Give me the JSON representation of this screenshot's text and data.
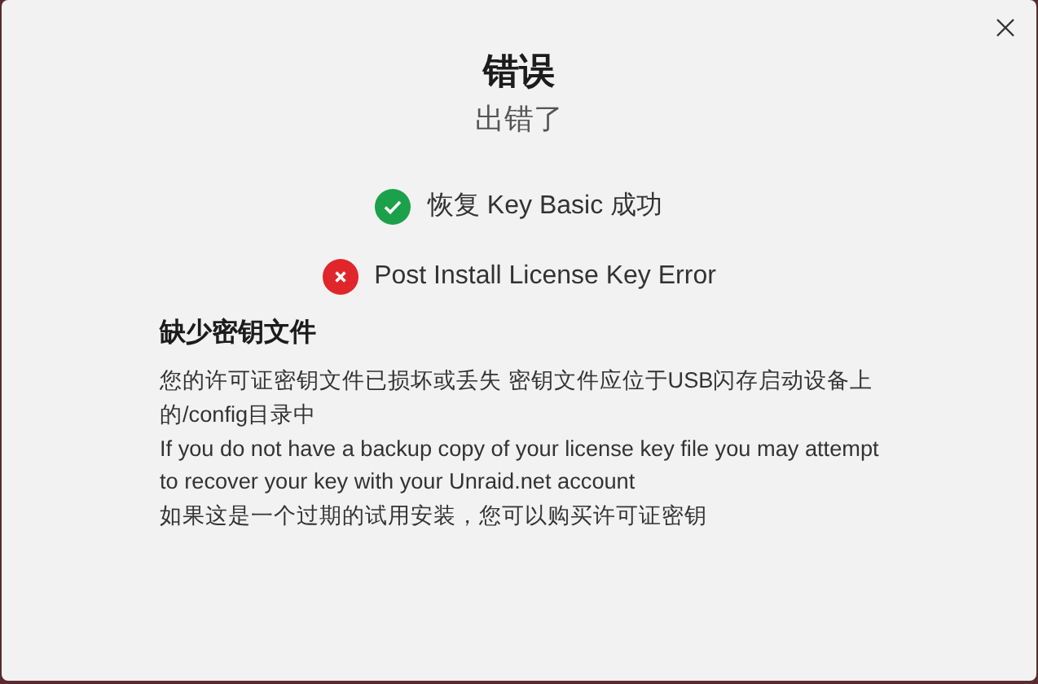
{
  "dialog": {
    "title": "错误",
    "subtitle": "出错了",
    "statuses": [
      {
        "kind": "success",
        "text": "恢复 Key Basic 成功"
      },
      {
        "kind": "error",
        "text": "Post Install License Key Error"
      }
    ],
    "section": {
      "heading": "缺少密钥文件",
      "paragraphs": [
        "您的许可证密钥文件已损坏或丢失 密钥文件应位于USB闪存启动设备上的/config目录中",
        "If you do not have a backup copy of your license key file you may attempt to recover your key with your Unraid.net account",
        "如果这是一个过期的试用安装，您可以购买许可证密钥"
      ]
    }
  }
}
